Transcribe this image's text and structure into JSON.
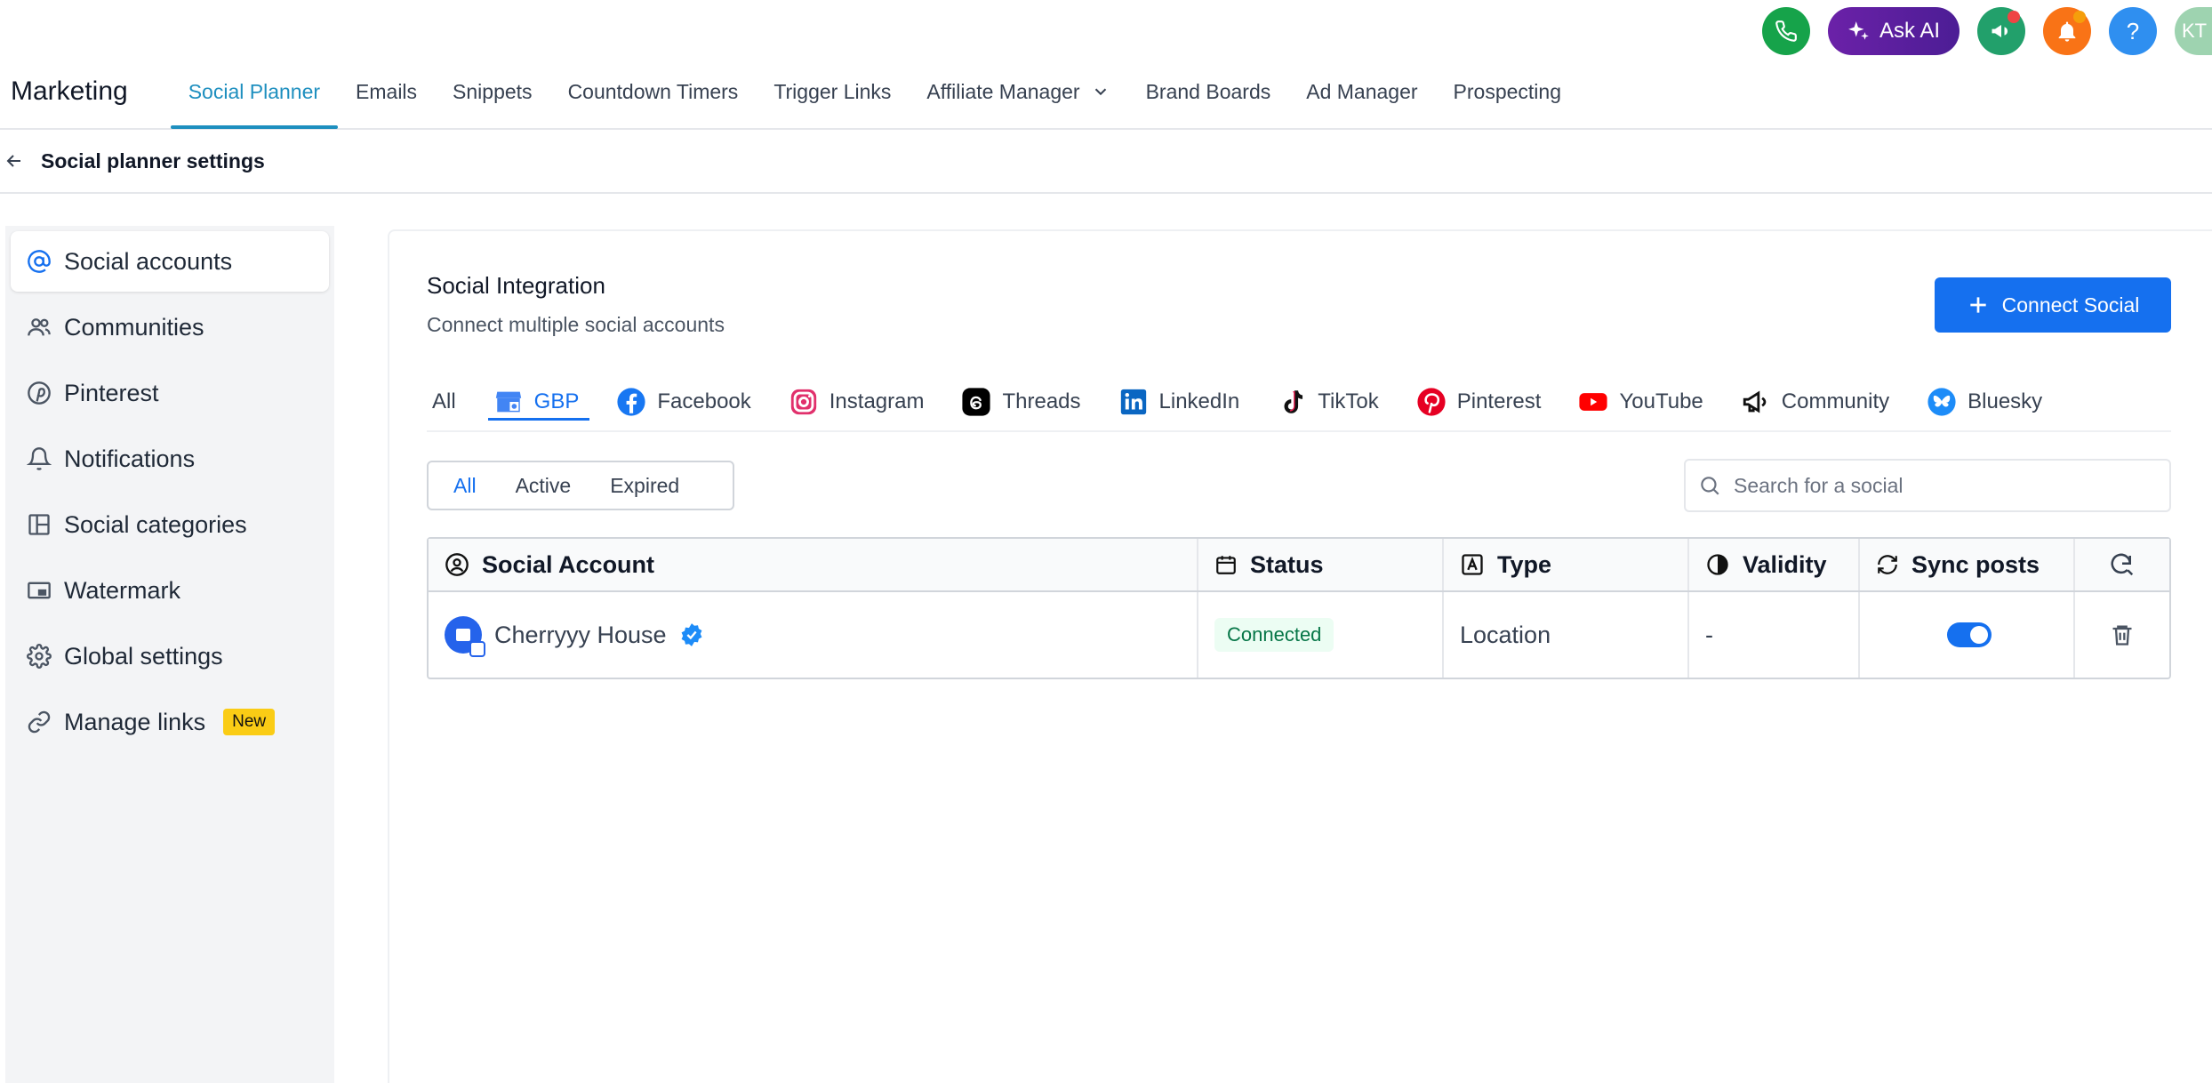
{
  "utility": {
    "ask_ai_label": "Ask AI",
    "help_label": "?",
    "avatar_initials": "KT",
    "colors": {
      "phone": "#16a34a",
      "megaphone": "#22a06b",
      "bell": "#f97316",
      "help": "#2f8ff0",
      "badge_red": "#ef4444",
      "badge_orange": "#f59e0b"
    }
  },
  "nav": {
    "brand": "Marketing",
    "tabs": [
      "Social Planner",
      "Emails",
      "Snippets",
      "Countdown Timers",
      "Trigger Links",
      "Affiliate Manager",
      "Brand Boards",
      "Ad Manager",
      "Prospecting"
    ],
    "active_tab": "Social Planner"
  },
  "breadcrumb": {
    "title": "Social planner settings"
  },
  "sidebar": {
    "items": [
      {
        "label": "Social accounts",
        "icon": "at-icon"
      },
      {
        "label": "Communities",
        "icon": "users-icon"
      },
      {
        "label": "Pinterest",
        "icon": "pinterest-icon"
      },
      {
        "label": "Notifications",
        "icon": "bell-icon"
      },
      {
        "label": "Social categories",
        "icon": "layout-icon"
      },
      {
        "label": "Watermark",
        "icon": "watermark-icon"
      },
      {
        "label": "Global settings",
        "icon": "gear-icon"
      },
      {
        "label": "Manage links",
        "icon": "link-icon",
        "badge": "New"
      }
    ],
    "active_item": "Social accounts"
  },
  "main": {
    "title": "Social Integration",
    "subtitle": "Connect multiple social accounts",
    "connect_button": "Connect Social",
    "platform_tabs": [
      "All",
      "GBP",
      "Facebook",
      "Instagram",
      "Threads",
      "LinkedIn",
      "TikTok",
      "Pinterest",
      "YouTube",
      "Community",
      "Bluesky"
    ],
    "active_platform": "GBP",
    "filters": [
      "All",
      "Active",
      "Expired"
    ],
    "active_filter": "All",
    "search_placeholder": "Search for a social",
    "table": {
      "headers": [
        "Social Account",
        "Status",
        "Type",
        "Validity",
        "Sync posts"
      ],
      "rows": [
        {
          "account": "Cherryyy House",
          "status": "Connected",
          "type": "Location",
          "validity": "-",
          "sync": true
        }
      ]
    }
  }
}
